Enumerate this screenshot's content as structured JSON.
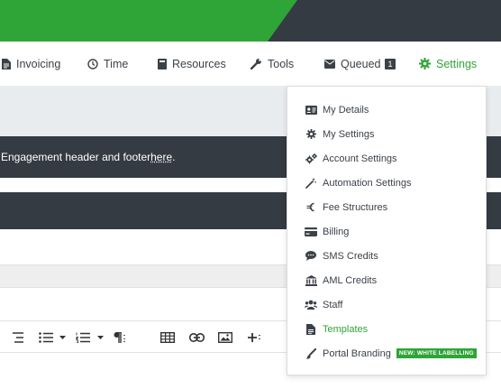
{
  "nav": {
    "items": [
      {
        "label": "Invoicing",
        "icon": "file-icon"
      },
      {
        "label": "Time",
        "icon": "clock-icon"
      },
      {
        "label": "Resources",
        "icon": "book-icon"
      },
      {
        "label": "Tools",
        "icon": "wrench-icon"
      },
      {
        "label": "Queued",
        "icon": "envelope-icon",
        "badge": "1"
      },
      {
        "label": "Settings",
        "icon": "gear-icon",
        "active": true
      }
    ]
  },
  "banner": {
    "text": "Engagement header and footer ",
    "link": "here",
    "suffix": "."
  },
  "settings_menu": {
    "items": [
      {
        "label": "My Details",
        "icon": "id-card-icon"
      },
      {
        "label": "My Settings",
        "icon": "gear-icon"
      },
      {
        "label": "Account Settings",
        "icon": "gears-icon"
      },
      {
        "label": "Automation Settings",
        "icon": "magic-wand-icon"
      },
      {
        "label": "Fee Structures",
        "icon": "euro-icon"
      },
      {
        "label": "Billing",
        "icon": "credit-card-icon"
      },
      {
        "label": "SMS Credits",
        "icon": "chat-bubble-icon"
      },
      {
        "label": "AML Credits",
        "icon": "bank-icon"
      },
      {
        "label": "Staff",
        "icon": "users-icon"
      },
      {
        "label": "Templates",
        "icon": "file-text-icon",
        "active": true
      },
      {
        "label": "Portal Branding",
        "icon": "paint-brush-icon",
        "tag": "NEW: WHITE LABELLING"
      }
    ]
  },
  "colors": {
    "brand_green": "#2ea536",
    "dark": "#343b43"
  }
}
